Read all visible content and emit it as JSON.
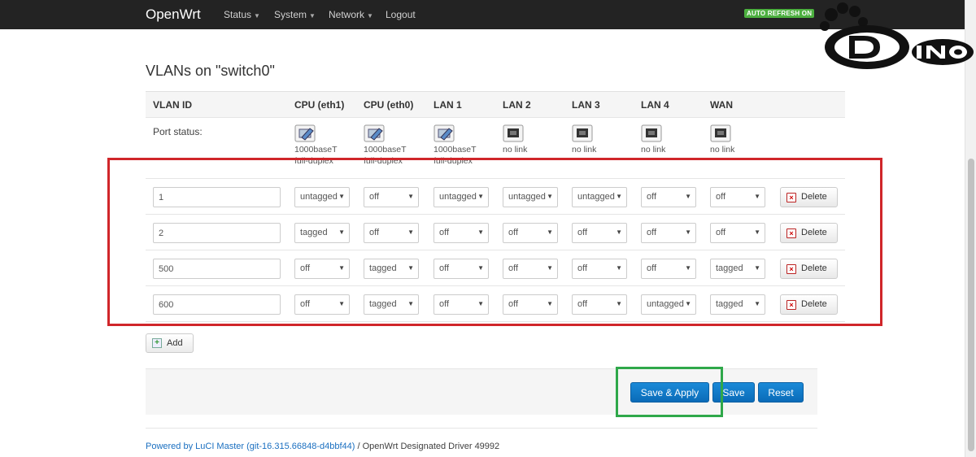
{
  "navbar": {
    "brand": "OpenWrt",
    "menus": [
      "Status",
      "System",
      "Network"
    ],
    "logout": "Logout",
    "auto_refresh": "AUTO REFRESH ON"
  },
  "watermark_logo": "Dino",
  "page_title": "VLANs on \"switch0\"",
  "table": {
    "headers": [
      "VLAN ID",
      "CPU (eth1)",
      "CPU (eth0)",
      "LAN 1",
      "LAN 2",
      "LAN 3",
      "LAN 4",
      "WAN"
    ],
    "port_status_label": "Port status:",
    "ports": [
      {
        "icon": "port-connected-icon",
        "line1": "1000baseT",
        "line2": "full-duplex"
      },
      {
        "icon": "port-connected-icon",
        "line1": "1000baseT",
        "line2": "full-duplex"
      },
      {
        "icon": "port-connected-icon",
        "line1": "1000baseT",
        "line2": "full-duplex"
      },
      {
        "icon": "port-disconnected-icon",
        "line1": "no link",
        "line2": ""
      },
      {
        "icon": "port-disconnected-icon",
        "line1": "no link",
        "line2": ""
      },
      {
        "icon": "port-disconnected-icon",
        "line1": "no link",
        "line2": ""
      },
      {
        "icon": "port-disconnected-icon",
        "line1": "no link",
        "line2": ""
      }
    ],
    "rows": [
      {
        "vlan_id": "1",
        "values": [
          "untagged",
          "off",
          "untagged",
          "untagged",
          "untagged",
          "off",
          "off"
        ]
      },
      {
        "vlan_id": "2",
        "values": [
          "tagged",
          "off",
          "off",
          "off",
          "off",
          "off",
          "off"
        ]
      },
      {
        "vlan_id": "500",
        "values": [
          "off",
          "tagged",
          "off",
          "off",
          "off",
          "off",
          "tagged"
        ]
      },
      {
        "vlan_id": "600",
        "values": [
          "off",
          "tagged",
          "off",
          "off",
          "off",
          "untagged",
          "tagged"
        ]
      }
    ],
    "delete_label": "Delete"
  },
  "add_label": "Add",
  "actions": {
    "save_apply": "Save & Apply",
    "save": "Save",
    "reset": "Reset"
  },
  "footer": {
    "link_text": "Powered by LuCI Master (git-16.315.66848-d4bbf44)",
    "rest_text": " / OpenWrt Designated Driver 49992"
  },
  "colors": {
    "primary_button": "#0a6bb8",
    "highlight_red": "#d0262a",
    "highlight_green": "#2fa84a",
    "refresh_badge": "#4caf3f"
  }
}
